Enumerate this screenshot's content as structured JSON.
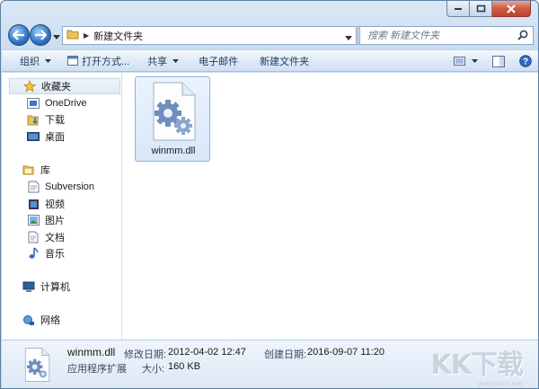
{
  "address": {
    "crumb": "新建文件夹"
  },
  "search": {
    "placeholder": "搜索 新建文件夹"
  },
  "toolbar": {
    "organize": "组织",
    "open_with": "打开方式...",
    "share": "共享",
    "email": "电子邮件",
    "new_folder": "新建文件夹"
  },
  "nav": {
    "favorites": "收藏夹",
    "onedrive": "OneDrive",
    "downloads": "下载",
    "desktop": "桌面",
    "libraries": "库",
    "subversion": "Subversion",
    "videos": "视频",
    "pictures": "图片",
    "documents": "文档",
    "music": "音乐",
    "computer": "计算机",
    "network": "网络"
  },
  "files": [
    {
      "name": "winmm.dll",
      "icon": "dll-gear-icon"
    }
  ],
  "details": {
    "name": "winmm.dll",
    "type": "应用程序扩展",
    "modified_label": "修改日期:",
    "modified_value": "2012-04-02 12:47",
    "size_label": "大小:",
    "size_value": "160 KB",
    "created_label": "创建日期:",
    "created_value": "2016-09-07 11:20"
  },
  "watermark": {
    "logo": "KK下载",
    "url": "www.kkx.net"
  },
  "colors": {
    "selection": "#d8e7f8",
    "selection_border": "#8db2e0",
    "frame": "#c6daef"
  }
}
